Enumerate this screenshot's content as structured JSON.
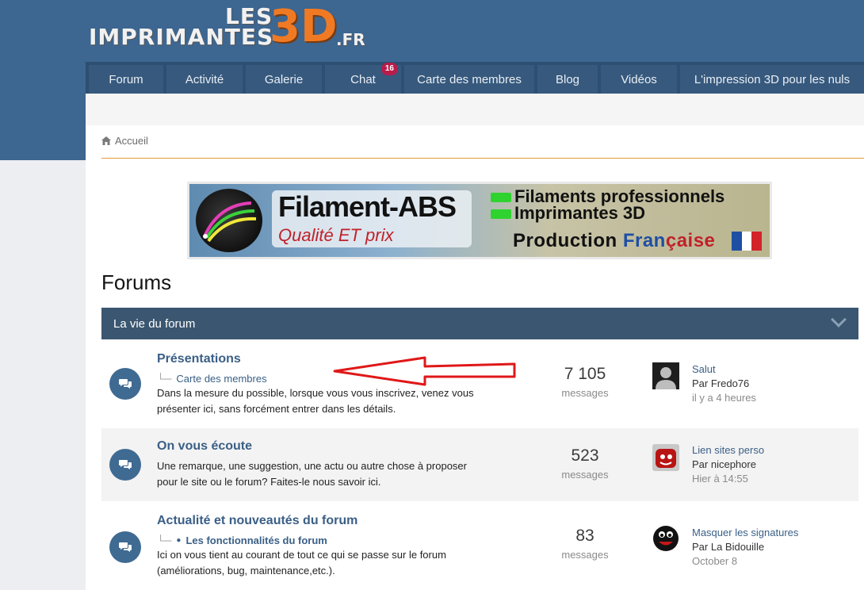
{
  "logo": {
    "les": "LES",
    "impr": "IMPRIMANTES",
    "three_d": "3D",
    "tld": ".FR"
  },
  "nav": [
    {
      "label": "Forum"
    },
    {
      "label": "Activité"
    },
    {
      "label": "Galerie"
    },
    {
      "label": "Chat",
      "badge": "16"
    },
    {
      "label": "Carte des membres"
    },
    {
      "label": "Blog"
    },
    {
      "label": "Vidéos"
    },
    {
      "label": "L'impression 3D pour les nuls"
    }
  ],
  "breadcrumb": {
    "icon": "home-icon",
    "label": "Accueil"
  },
  "banner": {
    "brand": "Filament-ABS",
    "tagline": "Qualité ET prix",
    "line1": "Filaments professionnels",
    "line2": "Imprimantes 3D",
    "production": "Production",
    "francaise_a": "Fran",
    "francaise_b": "çaise"
  },
  "page_title": "Forums",
  "category": {
    "title": "La vie du forum"
  },
  "forums": [
    {
      "title": "Présentations",
      "sub": "Carte des membres",
      "description": "Dans la mesure du possible, lorsque vous vous inscrivez, venez vous présenter ici, sans forcément entrer dans les détails.",
      "count": "7 105",
      "count_label": "messages",
      "last_title": "Salut",
      "last_by": "Par Fredo76",
      "last_time": "il y a 4 heures"
    },
    {
      "title": "On vous écoute",
      "description": "Une remarque, une suggestion, une actu ou autre chose à proposer pour le site ou le forum? Faites-le nous savoir ici.",
      "count": "523",
      "count_label": "messages",
      "last_title": "Lien sites perso",
      "last_by": "Par nicephore",
      "last_time": "Hier à 14:55"
    },
    {
      "title": "Actualité et nouveautés du forum",
      "sub": "Les fonctionnalités du forum",
      "description": "Ici on vous tient au courant de tout ce qui se passe sur le forum (améliorations, bug, maintenance,etc.).",
      "count": "83",
      "count_label": "messages",
      "last_title": "Masquer les signatures",
      "last_by": "Par La Bidouille",
      "last_time": "October 8"
    }
  ],
  "colors": {
    "header_blue": "#3d6690",
    "nav_dark": "#2c4f72",
    "link_blue": "#3a5f86",
    "accent_orange": "#e3973e",
    "badge_red": "#b71c4b",
    "annotation_red": "#e01818"
  }
}
